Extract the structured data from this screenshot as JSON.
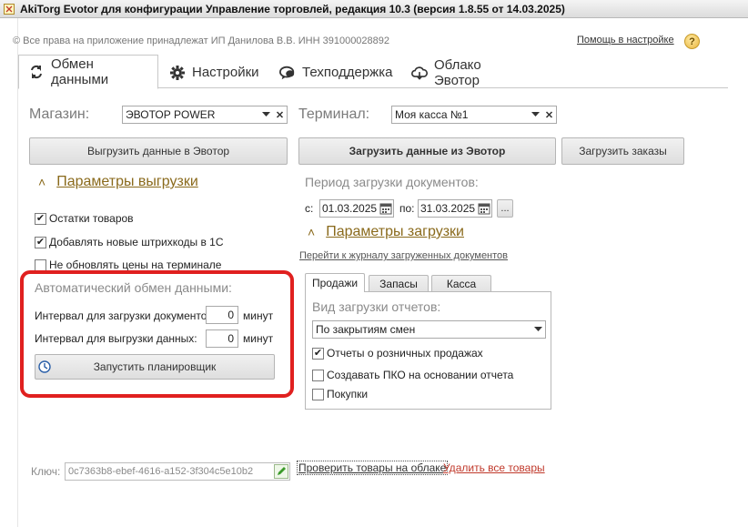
{
  "window": {
    "title": "AkiTorg Evotor для конфигурации Управление торговлей, редакция 10.3 (версия 1.8.55 от 14.03.2025)"
  },
  "header": {
    "copyright": "© Все права на приложение принадлежат ИП Данилова В.В.  ИНН 391000028892",
    "help_link": "Помощь в настройке",
    "help_icon_glyph": "?"
  },
  "tabs": [
    {
      "label": "Обмен данными",
      "icon": "exchange-icon",
      "active": true
    },
    {
      "label": "Настройки",
      "icon": "gear-icon",
      "active": false
    },
    {
      "label": "Техподдержка",
      "icon": "chat-icon",
      "active": false
    },
    {
      "label": "Облако Эвотор",
      "icon": "cloud-icon",
      "active": false
    }
  ],
  "store": {
    "label": "Магазин:",
    "value": "ЭВОТОР POWER"
  },
  "terminal": {
    "label": "Терминал:",
    "value": "Моя касса №1"
  },
  "buttons": {
    "upload": "Выгрузить данные в Эвотор",
    "download": "Загрузить данные из Эвотор",
    "orders": "Загрузить заказы",
    "scheduler": "Запустить планировщик"
  },
  "upload_params": {
    "title": "Параметры выгрузки",
    "checkboxes": [
      {
        "label": "Остатки товаров",
        "checked": true
      },
      {
        "label": "Добавлять новые штрихкоды в 1С",
        "checked": true
      },
      {
        "label": "Не обновлять цены на терминале",
        "checked": false
      }
    ]
  },
  "auto_exchange": {
    "title": "Автоматический обмен данными:",
    "doc_interval_label": "Интервал для загрузки документов:",
    "doc_interval_value": "0",
    "data_interval_label": "Интервал для выгрузки данных:",
    "data_interval_value": "0",
    "unit": "минут"
  },
  "period": {
    "title": "Период загрузки документов:",
    "from_label": "с:",
    "from_value": "01.03.2025",
    "to_label": "по:",
    "to_value": "31.03.2025",
    "more_button": "..."
  },
  "download_params": {
    "title": "Параметры загрузки",
    "journal_link": "Перейти к журналу загруженных документов",
    "subtabs": [
      "Продажи",
      "Запасы",
      "Касса"
    ],
    "report_type_label": "Вид загрузки отчетов:",
    "report_type_value": "По закрытиям смен",
    "checkboxes": [
      {
        "label": "Отчеты о розничных продажах",
        "checked": true
      },
      {
        "label": "Создавать ПКО на основании отчета",
        "checked": false
      },
      {
        "label": "Покупки",
        "checked": false
      }
    ]
  },
  "key": {
    "label": "Ключ:",
    "value": "0c7363b8-ebef-4616-a152-3f304c5e10b2"
  },
  "footer_links": {
    "check": "Проверить товары на облаке",
    "delete": "Удалить все товары"
  },
  "colors": {
    "highlight_frame": "#e0201f",
    "section_title": "#8a6a1c",
    "delete_link": "#c0392b"
  }
}
